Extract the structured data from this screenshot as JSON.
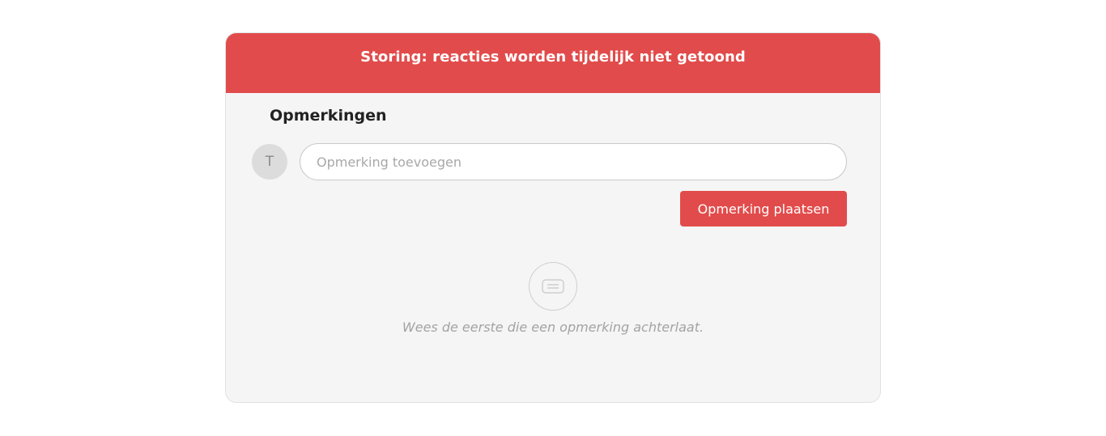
{
  "banner": {
    "message": "Storing: reacties worden tijdelijk niet getoond"
  },
  "comments": {
    "title": "Opmerkingen",
    "avatar_initial": "T",
    "input_placeholder": "Opmerking toevoegen",
    "input_value": "",
    "post_button_label": "Opmerking plaatsen",
    "empty_icon": "comment-icon",
    "empty_message": "Wees de eerste die een opmerking achterlaat."
  },
  "colors": {
    "accent": "#e24b4b",
    "card_background": "#f5f5f5"
  }
}
